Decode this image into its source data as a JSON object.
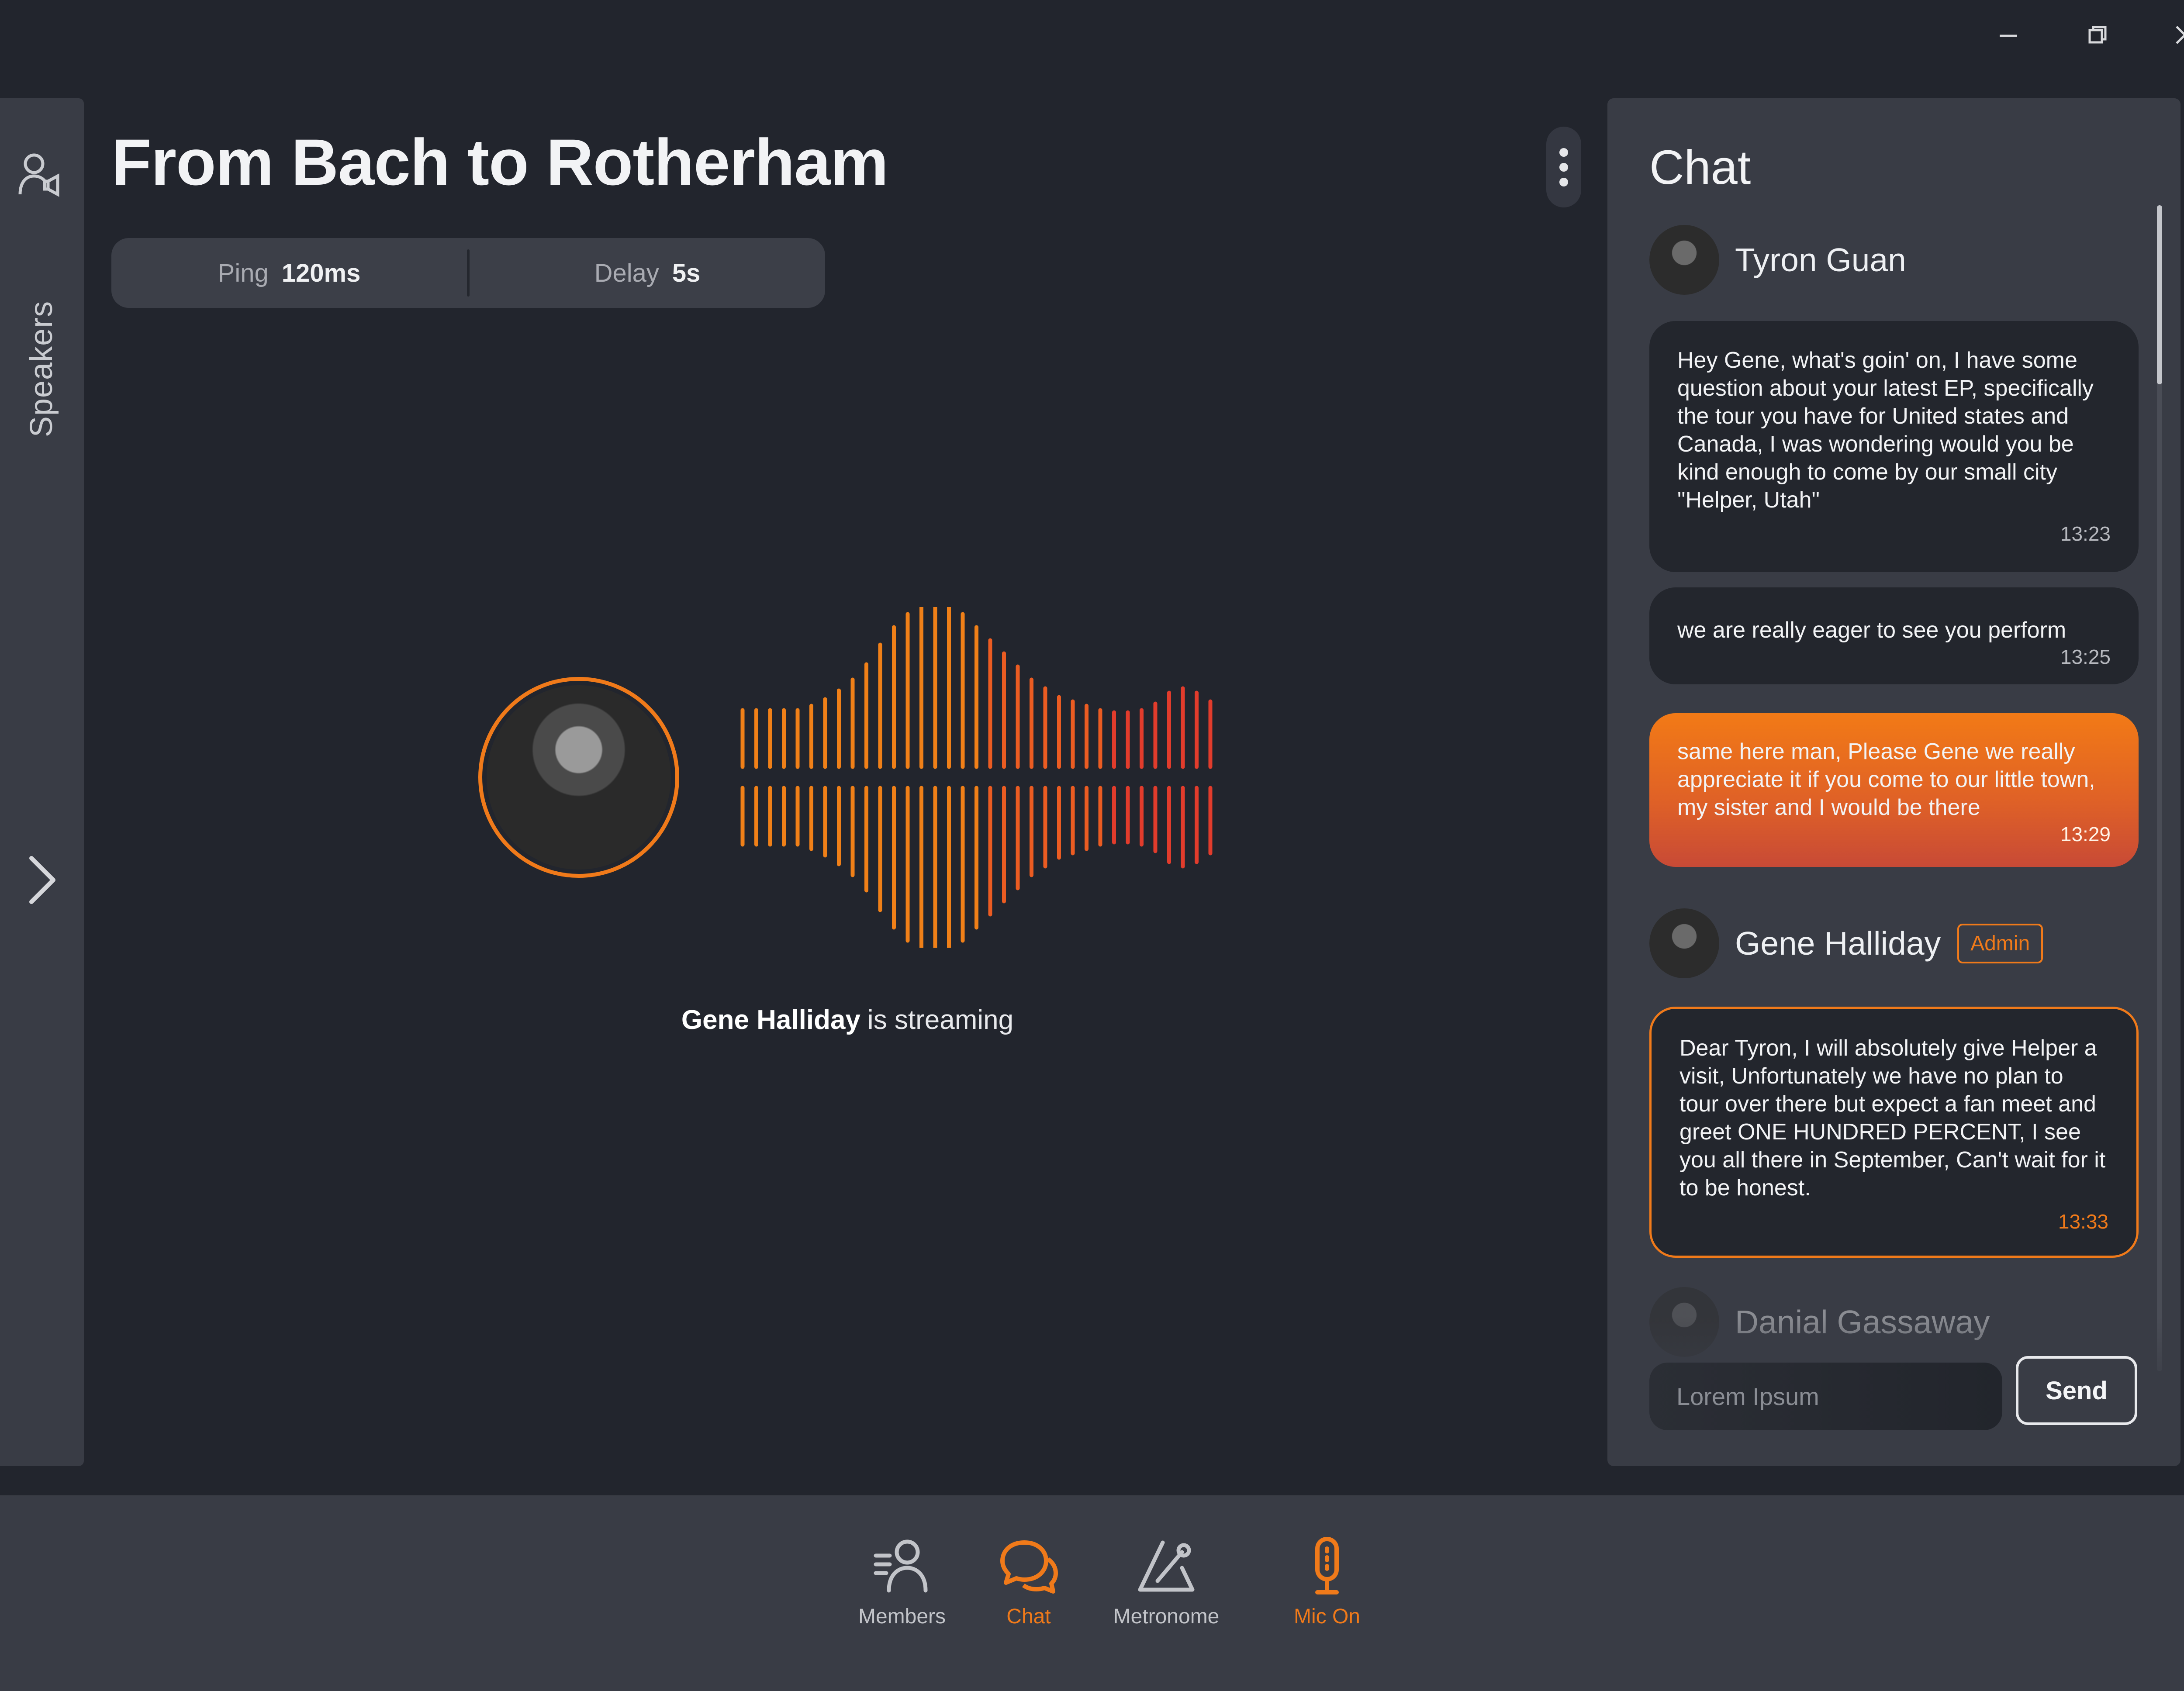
{
  "window": {
    "controls": [
      "minimize",
      "restore",
      "close"
    ]
  },
  "sidebar": {
    "label": "Speakers",
    "icon": "speakers-icon",
    "expand_icon": "chevron-right-icon"
  },
  "stage": {
    "title": "From Bach to Rotherham",
    "stats": [
      {
        "label": "Ping",
        "value": "120ms"
      },
      {
        "label": "Delay",
        "value": "5s"
      }
    ],
    "streamer_name": "Gene Halliday",
    "streaming_text": "is streaming",
    "accent": "#f07a1a"
  },
  "chat": {
    "title": "Chat",
    "users": {
      "tyron": {
        "name": "Tyron Guan"
      },
      "gene": {
        "name": "Gene Halliday",
        "badge": "Admin"
      },
      "danial": {
        "name": "Danial Gassaway"
      }
    },
    "messages": [
      {
        "text": "Hey Gene, what's goin' on, I have some question about your latest EP, specifically the tour you have for United states and Canada, I was wondering would you be kind enough to come by our small city \"Helper, Utah\"",
        "time": "13:23"
      },
      {
        "text": "we are really eager to see you perform",
        "time": "13:25"
      },
      {
        "text": "same here man, Please Gene we really appreciate it if you come to our little town, my sister and I would be there",
        "time": "13:29"
      },
      {
        "text": "Dear Tyron, I will absolutely give Helper a visit, Unfortunately we have no plan to tour over there but expect a fan meet and greet ONE HUNDRED PERCENT, I see you all there in September, Can't wait for it to be honest.",
        "time": "13:33"
      }
    ],
    "input_placeholder": "Lorem Ipsum",
    "send_label": "Send"
  },
  "toolbar": {
    "items": [
      {
        "label": "Members",
        "icon": "members-icon",
        "active": false
      },
      {
        "label": "Chat",
        "icon": "chat-icon",
        "active": true
      },
      {
        "label": "Metronome",
        "icon": "metronome-icon",
        "active": false
      },
      {
        "label": "Mic On",
        "icon": "mic-icon",
        "active": true
      }
    ]
  }
}
